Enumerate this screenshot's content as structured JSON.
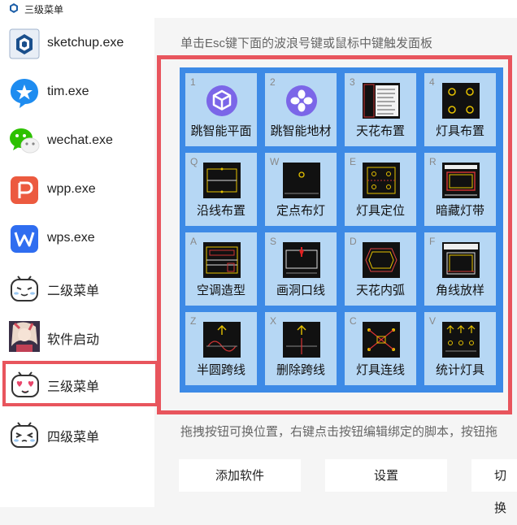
{
  "window": {
    "title": "三级菜单"
  },
  "sidebar": {
    "items": [
      {
        "label": "sketchup.exe",
        "icon": "sketchup-icon"
      },
      {
        "label": "tim.exe",
        "icon": "tim-icon"
      },
      {
        "label": "wechat.exe",
        "icon": "wechat-icon"
      },
      {
        "label": "wpp.exe",
        "icon": "wpp-icon"
      },
      {
        "label": "wps.exe",
        "icon": "wps-icon"
      },
      {
        "label": "二级菜单",
        "icon": "bilibili-face-icon"
      },
      {
        "label": "软件启动",
        "icon": "anime-avatar-icon"
      },
      {
        "label": "三级菜单",
        "icon": "heart-eyes-face-icon",
        "selected": true
      },
      {
        "label": "四级菜单",
        "icon": "squint-face-icon"
      }
    ]
  },
  "main": {
    "hint_top": "单击Esc键下面的波浪号键或鼠标中键触发面板",
    "grid": [
      {
        "key": "1",
        "label": "跳智能平面",
        "icon": "cube-icon"
      },
      {
        "key": "2",
        "label": "跳智能地材",
        "icon": "tiles-icon"
      },
      {
        "key": "3",
        "label": "天花布置",
        "icon": "menu-thumbnail-icon"
      },
      {
        "key": "4",
        "label": "灯具布置",
        "icon": "lamps-thumbnail-icon"
      },
      {
        "key": "Q",
        "label": "沿线布置",
        "icon": "line-layout-thumbnail-icon"
      },
      {
        "key": "W",
        "label": "定点布灯",
        "icon": "point-lamp-thumbnail-icon"
      },
      {
        "key": "E",
        "label": "灯具定位",
        "icon": "lamp-position-thumbnail-icon"
      },
      {
        "key": "R",
        "label": "暗藏灯带",
        "icon": "hidden-strip-thumbnail-icon"
      },
      {
        "key": "A",
        "label": "空调造型",
        "icon": "ac-thumbnail-icon"
      },
      {
        "key": "S",
        "label": "画洞口线",
        "icon": "opening-line-thumbnail-icon"
      },
      {
        "key": "D",
        "label": "天花内弧",
        "icon": "ceiling-arc-thumbnail-icon"
      },
      {
        "key": "F",
        "label": "角线放样",
        "icon": "corner-line-thumbnail-icon"
      },
      {
        "key": "Z",
        "label": "半圆跨线",
        "icon": "semicircle-thumbnail-icon"
      },
      {
        "key": "X",
        "label": "删除跨线",
        "icon": "delete-line-thumbnail-icon"
      },
      {
        "key": "C",
        "label": "灯具连线",
        "icon": "lamp-connect-thumbnail-icon"
      },
      {
        "key": "V",
        "label": "统计灯具",
        "icon": "count-lamps-thumbnail-icon"
      }
    ],
    "hint_bottom": "拖拽按钮可换位置，右键点击按钮编辑绑定的脚本，按钮拖",
    "buttons": {
      "add": "添加软件",
      "settings": "设置",
      "switch": "切换"
    }
  },
  "colors": {
    "panel_blue": "#3d8ae6",
    "cell_bg": "#b6d7f4",
    "highlight_red": "#e8555d"
  }
}
